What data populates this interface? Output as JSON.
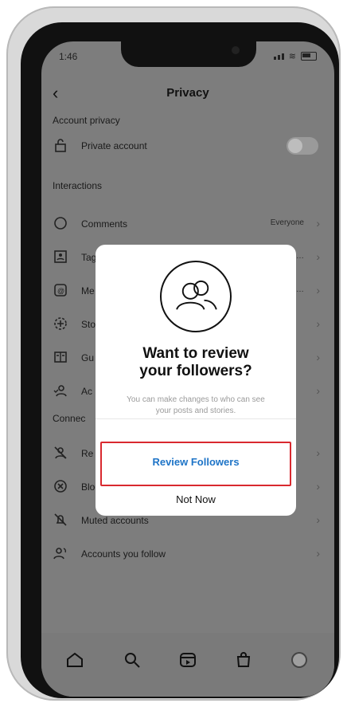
{
  "status": {
    "time": "1:46"
  },
  "header": {
    "title": "Privacy",
    "back_icon": "back-icon"
  },
  "sections": {
    "account_privacy": "Account privacy",
    "interactions": "Interactions",
    "connections": "Connec"
  },
  "rows": {
    "private_account": {
      "label": "Private account",
      "toggle": "off"
    },
    "comments": {
      "label": "Comments",
      "value": "Everyone"
    },
    "tags": {
      "label": "Tag",
      "value": "…"
    },
    "mentions": {
      "label": "Me",
      "value": "…"
    },
    "story": {
      "label": "Sto"
    },
    "guides": {
      "label": "Gu"
    },
    "activity": {
      "label": "Ac"
    },
    "restricted": {
      "label": "Re"
    },
    "blocked": {
      "label": "Blocked accounts"
    },
    "muted": {
      "label": "Muted accounts"
    },
    "following": {
      "label": "Accounts you follow"
    }
  },
  "modal": {
    "heading_line1": "Want to review",
    "heading_line2": "your followers?",
    "subtext_line1": "You can make changes to who can see",
    "subtext_line2": "your posts and stories.",
    "primary_label": "Review Followers",
    "secondary_label": "Not Now",
    "primary_outline_color": "#d9292f",
    "primary_text_color": "#1e74c7"
  },
  "tabbar": {
    "icons": [
      "home-icon",
      "search-icon",
      "reels-icon",
      "shop-icon",
      "profile-avatar"
    ]
  }
}
